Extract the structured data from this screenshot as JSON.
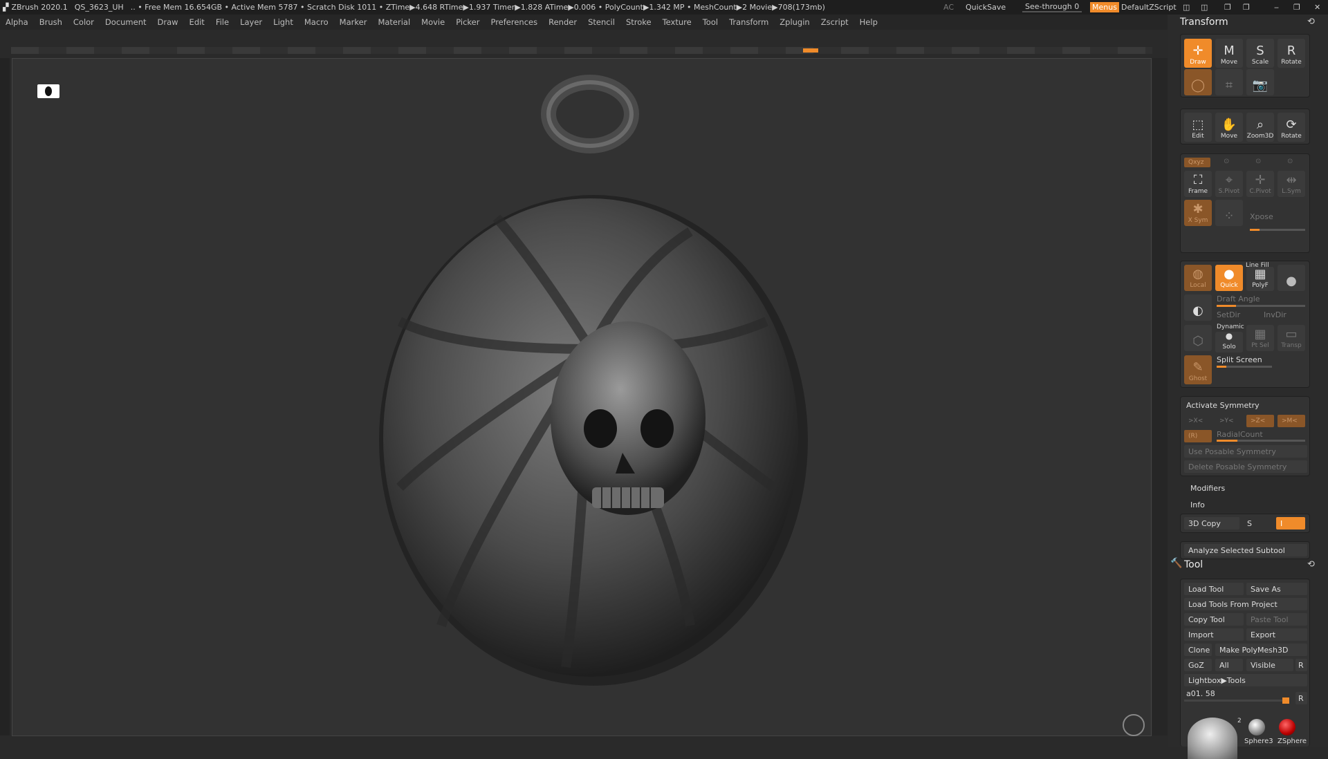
{
  "titlebar": {
    "app": "ZBrush 2020.1",
    "doc": "QS_3623_UH",
    "stats": ".. • Free Mem 16.654GB • Active Mem 5787 • Scratch Disk 1011 • ZTime▶4.648 RTime▶1.937 Timer▶1.828 ATime▶0.006 • PolyCount▶1.342 MP • MeshCount▶2 Movie▶708(173mb)",
    "ac": "AC",
    "quicksave": "QuickSave",
    "seethrough": "See-through  0",
    "menus": "Menus",
    "script": "DefaultZScript"
  },
  "menu": [
    "Alpha",
    "Brush",
    "Color",
    "Document",
    "Draw",
    "Edit",
    "File",
    "Layer",
    "Light",
    "Macro",
    "Marker",
    "Material",
    "Movie",
    "Picker",
    "Preferences",
    "Render",
    "Stencil",
    "Stroke",
    "Texture",
    "Tool",
    "Transform",
    "Zplugin",
    "Zscript",
    "Help"
  ],
  "transform": {
    "title": "Transform",
    "modes": [
      "Draw",
      "Move",
      "Scale",
      "Rotate"
    ],
    "nav": [
      "Edit",
      "Move",
      "Zoom3D",
      "Rotate"
    ],
    "axis": [
      "Frame",
      "S.Pivot",
      "C.Pivot",
      "L.Sym"
    ],
    "xyz": "Qxyz",
    "xsym": "X Sym",
    "xpose": "Xpose",
    "render": [
      "Local",
      "Quick",
      "PolyF",
      "Transp"
    ],
    "linefill": "Line Fill",
    "draft": "Draft Angle",
    "setdir": "SetDir",
    "invdir": "InvDir",
    "dynamic": "Dynamic",
    "solo": "Solo",
    "ptsel": "Pt Sel",
    "transp": "Transp",
    "ghost": "Ghost",
    "split": "Split Screen",
    "activate_symmetry": "Activate Symmetry",
    "sym_axes": [
      ">X<",
      ">Y<",
      ">Z<",
      ">M<"
    ],
    "r": "(R)",
    "radial": "RadialCount",
    "use_posable": "Use Posable Symmetry",
    "delete_posable": "Delete Posable Symmetry",
    "modifiers": "Modifiers",
    "info": "Info",
    "copy3d": "3D Copy",
    "s": "S",
    "i": "I",
    "analyze": "Analyze Selected Subtool"
  },
  "tool": {
    "title": "Tool",
    "load": "Load Tool",
    "saveas": "Save As",
    "loadproj": "Load Tools From Project",
    "copy": "Copy Tool",
    "paste": "Paste Tool",
    "import": "Import",
    "export": "Export",
    "clone": "Clone",
    "makepoly": "Make PolyMesh3D",
    "goz": "GoZ",
    "all": "All",
    "visible": "Visible",
    "rkey": "R",
    "lightbox": "Lightbox▶Tools",
    "current": "a01. 58",
    "count": "2",
    "thumbs": [
      "Sphere3",
      "ZSphere"
    ]
  }
}
